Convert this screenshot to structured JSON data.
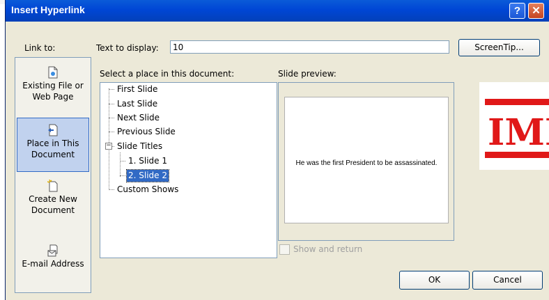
{
  "dialog": {
    "title": "Insert Hyperlink",
    "help_glyph": "?",
    "close_glyph": "✕"
  },
  "link_to": {
    "label": "Link to:",
    "items": [
      {
        "line1": "Existing File or",
        "line2": "Web Page",
        "icon": "existing-file-icon",
        "selected": false
      },
      {
        "line1": "Place in This",
        "line2": "Document",
        "icon": "place-in-document-icon",
        "selected": true
      },
      {
        "line1": "Create New",
        "line2": "Document",
        "icon": "create-new-document-icon",
        "selected": false
      },
      {
        "line1": "E-mail Address",
        "line2": "",
        "icon": "email-icon",
        "selected": false
      }
    ]
  },
  "text_to_display": {
    "label": "Text to display:",
    "value": "10"
  },
  "screentip_label": "ScreenTip...",
  "place": {
    "label": "Select a place in this document:",
    "tree": [
      {
        "label": "First Slide",
        "level": 0
      },
      {
        "label": "Last Slide",
        "level": 0
      },
      {
        "label": "Next Slide",
        "level": 0
      },
      {
        "label": "Previous Slide",
        "level": 0
      },
      {
        "label": "Slide Titles",
        "level": 0,
        "expanded": true
      },
      {
        "label": "1. Slide 1",
        "level": 1
      },
      {
        "label": "2. Slide 2",
        "level": 1,
        "selected": true
      },
      {
        "label": "Custom Shows",
        "level": 0
      }
    ]
  },
  "preview": {
    "label": "Slide preview:",
    "slide_text": "He was the first President to be assassinated.",
    "show_and_return_label": "Show and return",
    "show_and_return_checked": false
  },
  "buttons": {
    "ok": "OK",
    "cancel": "Cancel"
  },
  "overlay_stamp": {
    "text": "IMP",
    "color": "#e01818"
  },
  "colors": {
    "titlebar": "#0046d5",
    "selection": "#316ac5",
    "dialog_bg": "#ece9d8"
  }
}
